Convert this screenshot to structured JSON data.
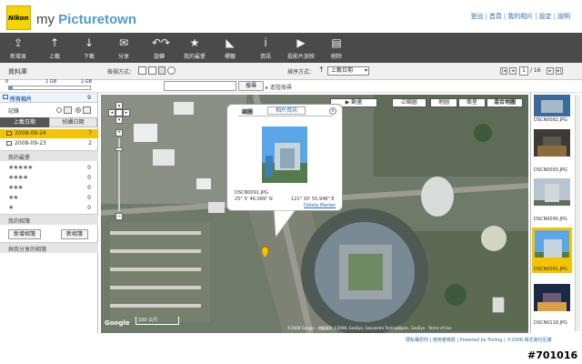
{
  "header": {
    "logo_text": "Nikon",
    "brand_prefix": "my ",
    "brand_name": "Picturetown",
    "links": [
      "登出",
      "首頁",
      "我的相片",
      "設定",
      "說明"
    ]
  },
  "toolbar": {
    "items": [
      {
        "label": "新增頁",
        "icon": "upload-box-icon"
      },
      {
        "label": "上載",
        "icon": "up-arrow-icon"
      },
      {
        "label": "下載",
        "icon": "down-arrow-icon"
      },
      {
        "label": "分享",
        "icon": "envelope-icon"
      },
      {
        "label": "旋轉",
        "icon": "rotate-icon"
      },
      {
        "label": "我的最愛",
        "icon": "star-icon"
      },
      {
        "label": "標籤",
        "icon": "tag-icon"
      },
      {
        "label": "資訊",
        "icon": "info-icon"
      },
      {
        "label": "投影片放映",
        "icon": "play-icon"
      },
      {
        "label": "刪除",
        "icon": "trash-icon"
      }
    ]
  },
  "sortbar": {
    "section_label": "資料庫",
    "view_label": "檢視方式：",
    "sort_label": "排序方式：",
    "sort_value": "上載日期",
    "page_current": "1",
    "page_total": "/ 16"
  },
  "storage": {
    "min_label": "0",
    "mid_label": "1 GB",
    "max_label": "2 GB",
    "used_fraction": 0.04
  },
  "search": {
    "button_label": "搜尋",
    "advanced_label": "進階搜尋",
    "placeholder": ""
  },
  "sidebar": {
    "all_photos": "所有相片",
    "all_count": "9",
    "records_label": "記錄",
    "tab_upload": "上載日期",
    "tab_shoot": "拍攝日期",
    "dates": [
      {
        "date": "2008-09-24",
        "count": "7",
        "selected": true
      },
      {
        "date": "2008-09-23",
        "count": "2",
        "selected": false
      }
    ],
    "favorites_label": "我的最愛",
    "ratings": [
      {
        "stars": "★★★★★",
        "count": "0"
      },
      {
        "stars": "★★★★",
        "count": "0"
      },
      {
        "stars": "★★★",
        "count": "0"
      },
      {
        "stars": "★★",
        "count": "0"
      },
      {
        "stars": "★",
        "count": "0"
      }
    ],
    "albums_label": "我的相簿",
    "new_album": "新增相簿",
    "new_folder": "新相簿",
    "shared_label": "與我分享的相簿"
  },
  "map": {
    "mode_buttons": [
      "動畫",
      "縮圖",
      "地圖",
      "衛星",
      "混合地圖"
    ],
    "popup": {
      "tab_thumb": "縮圖",
      "tab_info": "相片資訊",
      "filename": "DSCN0091.JPG",
      "lat": "25° 5' 46.089\" N",
      "lng": "121° 30' 55.948\" E",
      "delete_link": "Delete Marker"
    },
    "copyright": "©2008 Google - 地圖資料 ©2008, GeoEye, Geocentre Technologies, GeoEye - Terms of Use",
    "scale": "100 公尺",
    "google_logo": "Google"
  },
  "thumbs": [
    {
      "name": "DSCN0082.JPG"
    },
    {
      "name": "DSCN0093.JPG"
    },
    {
      "name": "DSCN0090.JPG"
    },
    {
      "name": "DSCN0091.JPG"
    },
    {
      "name": "DSCN0118.JPG"
    }
  ],
  "footer": {
    "links": "隱私權原則 | 使用者條款 | Powered by Picling | ©2008 株式會社尼康",
    "watermark": "#701016"
  },
  "colors": {
    "toolbar": "#4a4a4a",
    "selected_row": "#f5c400",
    "accent": "#2a6db0"
  }
}
